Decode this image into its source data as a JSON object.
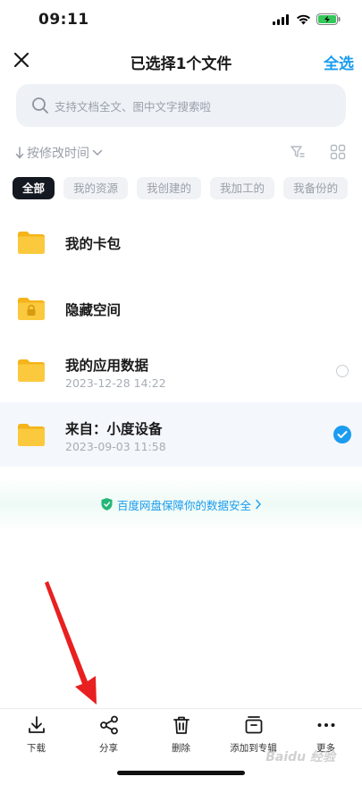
{
  "status_bar": {
    "time": "09:11"
  },
  "nav": {
    "title": "已选择1个文件",
    "select_all": "全选"
  },
  "search": {
    "placeholder": "支持文档全文、图中文字搜索啦"
  },
  "sort": {
    "label": "按修改时间"
  },
  "chips": [
    "全部",
    "我的资源",
    "我创建的",
    "我加工的",
    "我备份的"
  ],
  "files": [
    {
      "name": "我的卡包",
      "time": "",
      "icon": "folder-icon",
      "selected": false
    },
    {
      "name": "隐藏空间",
      "time": "",
      "icon": "lock-folder-icon",
      "selected": false
    },
    {
      "name": "我的应用数据",
      "time": "2023-12-28 14:22",
      "icon": "folder-icon",
      "selected": false
    },
    {
      "name": "来自：小度设备",
      "time": "2023-09-03 11:58",
      "icon": "folder-icon",
      "selected": true
    }
  ],
  "security_banner": {
    "text": "百度网盘保障你的数据安全"
  },
  "bottom_bar": [
    {
      "label": "下载",
      "icon": "download-icon"
    },
    {
      "label": "分享",
      "icon": "share-icon"
    },
    {
      "label": "删除",
      "icon": "trash-icon"
    },
    {
      "label": "添加到专辑",
      "icon": "album-icon"
    },
    {
      "label": "更多",
      "icon": "more-icon"
    }
  ],
  "watermark": "Baidu 经验",
  "colors": {
    "accent": "#1b9cf0",
    "folder": "#f9c531",
    "arrow": "#e8201f",
    "dark_chip": "#141821"
  }
}
